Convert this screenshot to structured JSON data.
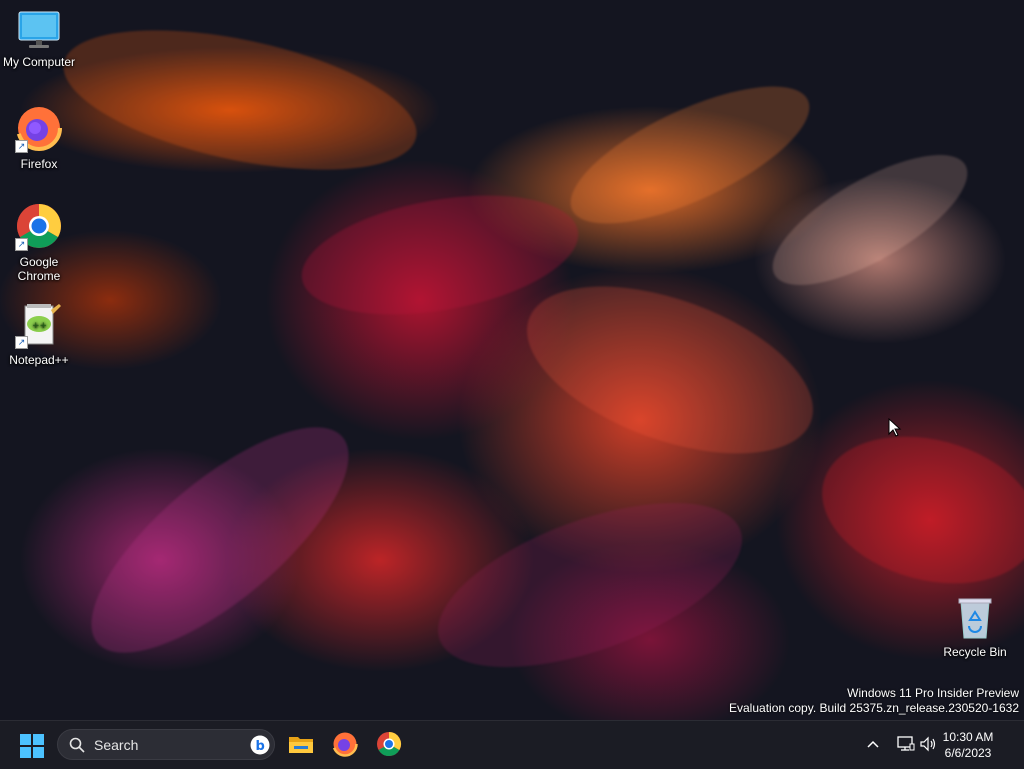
{
  "desktop_icons": [
    {
      "label": "My Computer",
      "icon": "monitor-icon"
    },
    {
      "label": "Firefox",
      "icon": "firefox-icon"
    },
    {
      "label": "Google Chrome",
      "icon": "chrome-icon"
    },
    {
      "label": "Notepad++",
      "icon": "notepadpp-icon"
    },
    {
      "label": "Recycle Bin",
      "icon": "recycle-bin-icon"
    }
  ],
  "watermark": {
    "line1": "Windows 11 Pro Insider Preview",
    "line2": "Evaluation copy. Build 25375.zn_release.230520-1632"
  },
  "taskbar": {
    "search_placeholder": "Search",
    "pinned_apps": [
      "file-explorer-icon",
      "firefox-icon",
      "chrome-icon"
    ],
    "clock": {
      "time": "10:30 AM",
      "date": "6/6/2023"
    }
  },
  "colors": {
    "taskbar_bg": "#1b1c24",
    "accent": "#0f6cbd",
    "search_bg": "#2c2d35"
  }
}
